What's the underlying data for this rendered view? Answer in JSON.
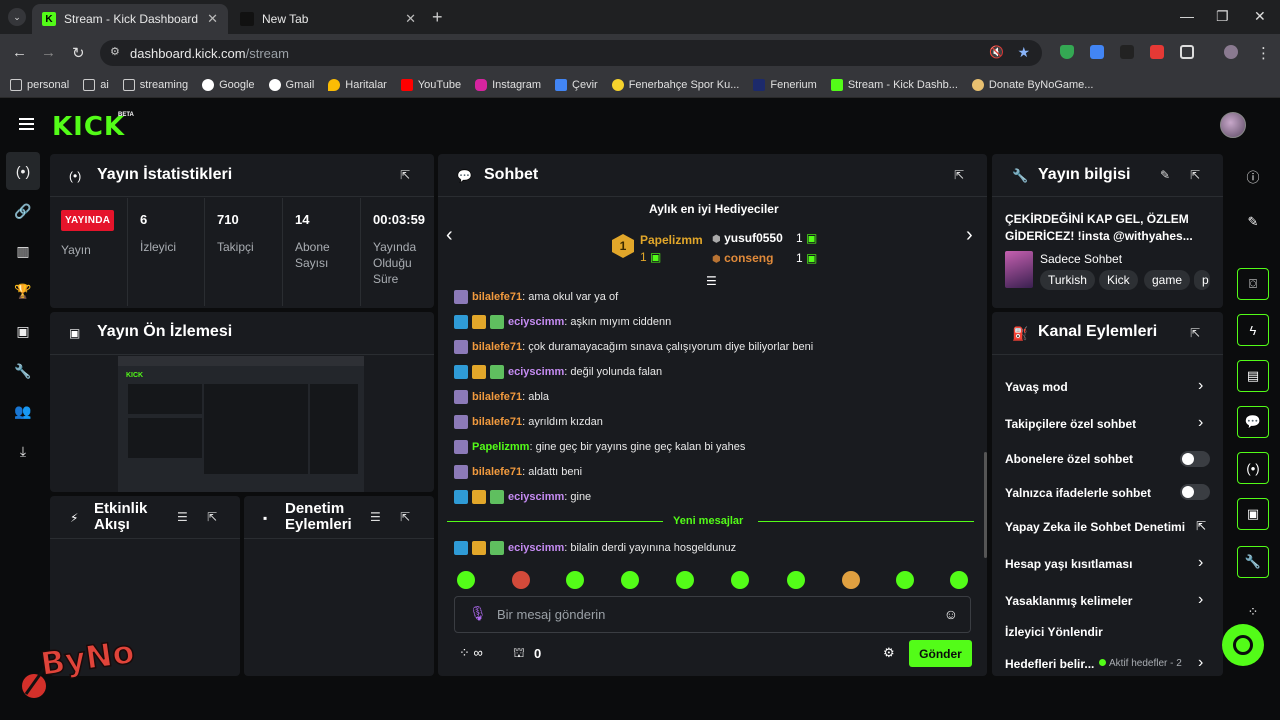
{
  "browser": {
    "tabs": [
      {
        "label": "Stream - Kick Dashboard",
        "active": true
      },
      {
        "label": "New Tab",
        "active": false
      }
    ],
    "url_host": "dashboard.kick.com",
    "url_path": "/stream",
    "bookmarks": [
      "personal",
      "ai",
      "streaming",
      "Google",
      "Gmail",
      "Haritalar",
      "YouTube",
      "Instagram",
      "Çevir",
      "Fenerbahçe Spor Ku...",
      "Fenerium",
      "Stream - Kick Dashb...",
      "Donate ByNoGame..."
    ]
  },
  "app": {
    "logo": "KICK",
    "logo_badge": "BETA",
    "accent": "#53fc18"
  },
  "stats_panel": {
    "title": "Yayın İstatistikleri",
    "live_badge": "YAYINDA",
    "live_label": "Yayın",
    "stats": [
      {
        "value": "6",
        "label": "İzleyici"
      },
      {
        "value": "710",
        "label": "Takipçi"
      },
      {
        "value": "14",
        "label": "Abone Sayısı"
      },
      {
        "value": "00:03:59",
        "label": "Yayında Olduğu Süre"
      }
    ]
  },
  "preview_panel": {
    "title": "Yayın Ön İzlemesi",
    "preview_logo": "KICK"
  },
  "activity_panel": {
    "title": "Etkinlik Akışı"
  },
  "moderation_panel": {
    "title": "Denetim Eylemleri"
  },
  "chat": {
    "title": "Sohbet",
    "gifters_title": "Aylık en iyi Hediyeciler",
    "gifters": [
      {
        "rank": "1",
        "name": "Papelizmm",
        "count": "1"
      },
      {
        "name": "yusuf0550",
        "count": "1"
      },
      {
        "name": "conseng",
        "count": "1"
      }
    ],
    "messages": [
      {
        "user": "bilalefe71",
        "text": ": ama okul var ya of"
      },
      {
        "user": "eciyscimm",
        "text": ": aşkın mıyım ciddenn"
      },
      {
        "user": "bilalefe71",
        "text": ": çok duramayacağım sınava çalışıyorum diye biliyorlar beni"
      },
      {
        "user": "eciyscimm",
        "text": ": değil yolunda falan"
      },
      {
        "user": "bilalefe71",
        "text": ": abla"
      },
      {
        "user": "bilalefe71",
        "text": ": ayrıldım kızdan"
      },
      {
        "user": "Papelizmm",
        "text": ": gine geç bir yayıns gine geç kalan bi yahes"
      },
      {
        "user": "bilalefe71",
        "text": ": aldattı beni"
      },
      {
        "user": "eciyscimm",
        "text": ": gine"
      }
    ],
    "new_messages_label": "Yeni mesajlar",
    "new_message": {
      "user": "eciyscimm",
      "text": ": bilalin derdi yayınına hosgeldunuz"
    },
    "input_placeholder": "Bir mesaj gönderin",
    "points_value": "0",
    "send_label": "Gönder"
  },
  "stream_info": {
    "title": "Yayın bilgisi",
    "stream_title": "ÇEKİRDEĞİNİ KAP GEL, ÖZLEM GİDERİCEZ! !insta @withyahes...",
    "category": "Sadece Sohbet",
    "tags": [
      "Turkish",
      "Kick",
      "game",
      "p"
    ]
  },
  "channel_actions": {
    "title": "Kanal Eylemleri",
    "items": [
      {
        "label": "Yavaş mod",
        "control": "chevron"
      },
      {
        "label": "Takipçilere özel sohbet",
        "control": "chevron"
      },
      {
        "label": "Abonelere özel sohbet",
        "control": "toggle"
      },
      {
        "label": "Yalnızca ifadelerle sohbet",
        "control": "toggle"
      },
      {
        "label": "Yapay Zeka ile Sohbet Denetimi",
        "control": "external"
      },
      {
        "label": "Hesap yaşı kısıtlaması",
        "control": "chevron"
      },
      {
        "label": "Yasaklanmış kelimeler",
        "control": "chevron"
      },
      {
        "label": "İzleyici Yönlendir",
        "control": "none"
      },
      {
        "label": "Hedefleri belir...",
        "control": "chevron",
        "sub": "Aktif hedefler - 2"
      }
    ]
  },
  "overlay": {
    "watermark": "ByNo"
  }
}
